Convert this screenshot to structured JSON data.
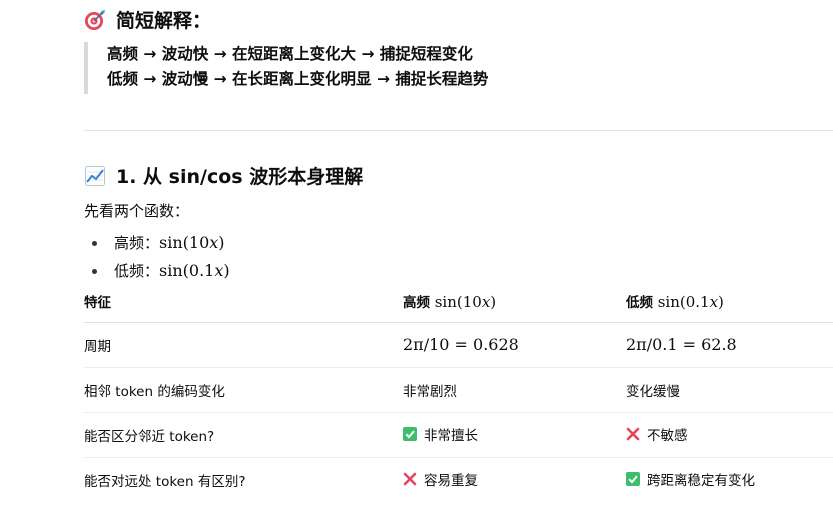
{
  "summary": {
    "heading": "简短解释：",
    "icon": "target-icon",
    "lines": [
      "高频 → 波动快 → 在短距离上变化大 → 捕捉短程变化",
      "低频 → 波动慢 → 在长距离上变化明显 → 捕捉长程趋势"
    ]
  },
  "section1": {
    "heading": "1. 从 sin/cos 波形本身理解",
    "icon": "chart-increasing-icon",
    "intro": "先看两个函数：",
    "bullets": [
      {
        "label": "高频：",
        "math": "sin(10x)"
      },
      {
        "label": "低频：",
        "math": "sin(0.1x)"
      }
    ]
  },
  "table": {
    "headers": [
      "特征",
      "高频",
      "低频"
    ],
    "header_math": [
      "",
      "sin(10x)",
      "sin(0.1x)"
    ],
    "rows": [
      {
        "feature": "周期",
        "high": "2π/10 = 0.628",
        "low": "2π/0.1 = 62.8",
        "high_icon": "",
        "low_icon": ""
      },
      {
        "feature": "相邻 token 的编码变化",
        "high": "非常剧烈",
        "low": "变化缓慢",
        "high_icon": "",
        "low_icon": ""
      },
      {
        "feature": "能否区分邻近 token?",
        "high": "非常擅长",
        "low": "不敏感",
        "high_icon": "check-mark-icon",
        "low_icon": "cross-mark-icon"
      },
      {
        "feature": "能否对远处 token 有区别?",
        "high": "容易重复",
        "low": "跨距离稳定有变化",
        "high_icon": "cross-mark-icon",
        "low_icon": "check-mark-icon"
      }
    ]
  },
  "colors": {
    "check": "#3ebd6a",
    "cross": "#e8455c",
    "quote_border": "#d9d9d9"
  }
}
